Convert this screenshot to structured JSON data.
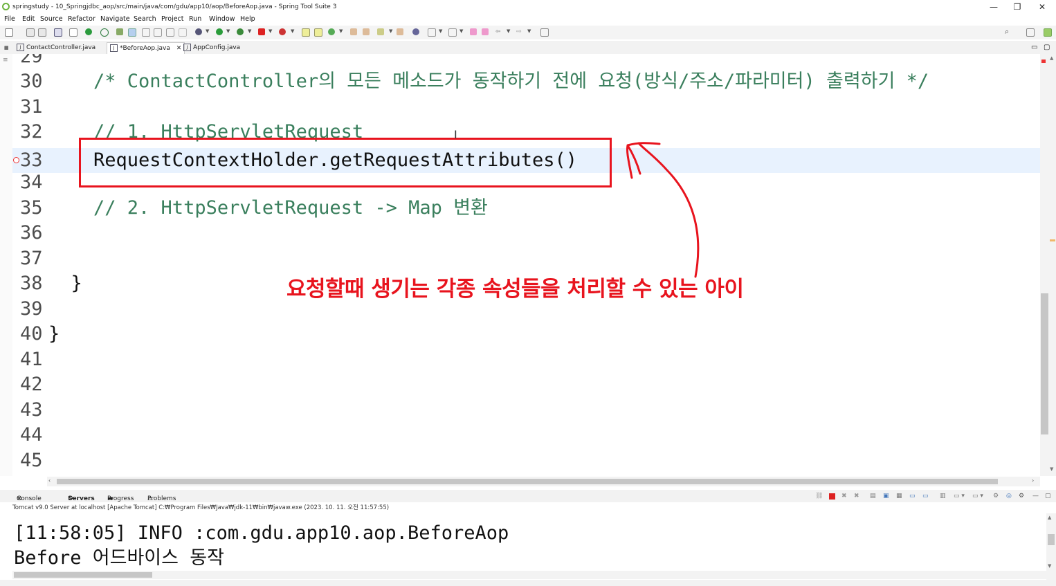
{
  "window": {
    "title": "springstudy - 10_Springjdbc_aop/src/main/java/com/gdu/app10/aop/BeforeAop.java - Spring Tool Suite 3",
    "minimize": "—",
    "restore": "❐",
    "close": "✕"
  },
  "menu": [
    "File",
    "Edit",
    "Source",
    "Refactor",
    "Navigate",
    "Search",
    "Project",
    "Run",
    "Window",
    "Help"
  ],
  "tabs": [
    {
      "label": "ContactController.java",
      "active": false
    },
    {
      "label": "*BeforeAop.java",
      "active": true,
      "close": "✕"
    },
    {
      "label": "AppConfig.java",
      "active": false
    }
  ],
  "editor": {
    "lines": [
      {
        "num": "29",
        "text": "",
        "kind": "code"
      },
      {
        "num": "30",
        "text": "    /* ContactController의 모든 메소드가 동작하기 전에 요청(방식/주소/파라미터) 출력하기 */",
        "kind": "comment"
      },
      {
        "num": "31",
        "text": "",
        "kind": "code"
      },
      {
        "num": "32",
        "text": "    // 1. HttpServletRequest",
        "kind": "comment"
      },
      {
        "num": "33",
        "text": "    RequestContextHolder.getRequestAttributes()",
        "kind": "code"
      },
      {
        "num": "34",
        "text": "",
        "kind": "code"
      },
      {
        "num": "35",
        "text": "    // 2. HttpServletRequest -> Map 변환",
        "kind": "comment"
      },
      {
        "num": "36",
        "text": "",
        "kind": "code"
      },
      {
        "num": "37",
        "text": "",
        "kind": "code"
      },
      {
        "num": "38",
        "text": "  }",
        "kind": "code"
      },
      {
        "num": "39",
        "text": "",
        "kind": "code"
      },
      {
        "num": "40",
        "text": "}",
        "kind": "code"
      },
      {
        "num": "41",
        "text": "",
        "kind": "code"
      },
      {
        "num": "42",
        "text": "",
        "kind": "code"
      },
      {
        "num": "43",
        "text": "",
        "kind": "code"
      },
      {
        "num": "44",
        "text": "",
        "kind": "code"
      },
      {
        "num": "45",
        "text": "",
        "kind": "code"
      }
    ],
    "current_line": "33",
    "annotation": "요청할때 생기는 각종 속성들을 처리할 수 있는 아이"
  },
  "console_panel": {
    "tabs": [
      "Console",
      "Servers",
      "Progress",
      "Problems"
    ],
    "description": "Tomcat v9.0 Server at localhost [Apache Tomcat] C:₩Program Files₩Java₩jdk-11₩bin₩javaw.exe  (2023. 10. 11. 오전 11:57:55)",
    "output": [
      "[11:58:05] INFO :com.gdu.app10.aop.BeforeAop",
      "Before 어드바이스 동작"
    ]
  },
  "colors": {
    "accent_red": "#e8141e",
    "comment_green": "#3a7f5d",
    "current_line": "#e8f2fe",
    "change_bar": "#3e7ab6"
  }
}
